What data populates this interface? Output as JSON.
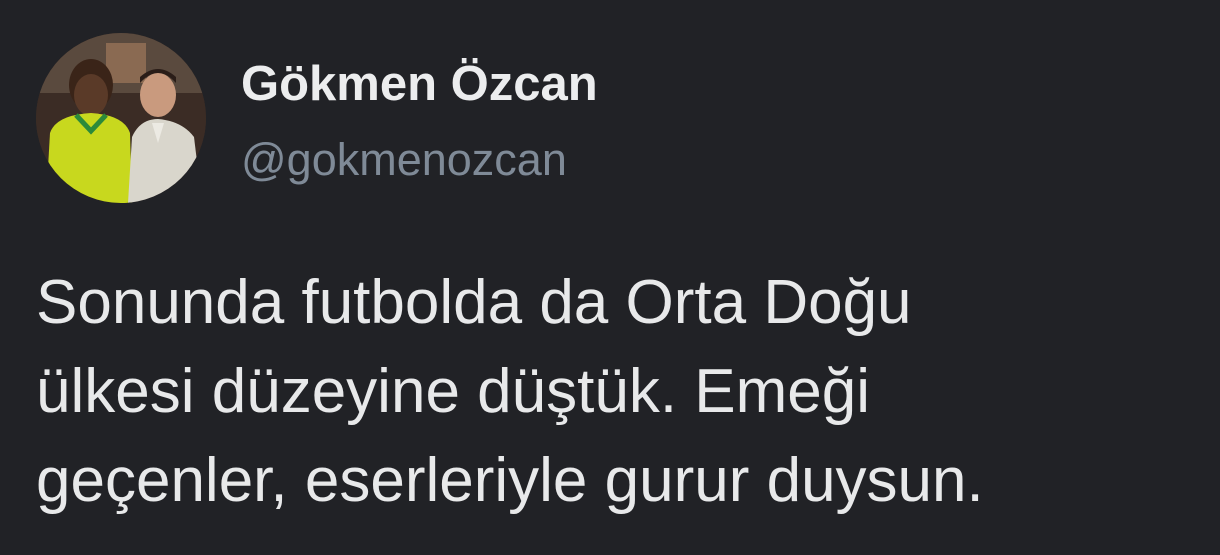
{
  "tweet": {
    "author": {
      "display_name": "Gökmen Özcan",
      "handle": "@gokmenozcan",
      "avatar_icon": "profile-photo"
    },
    "text_lines": [
      "Sonunda futbolda da Orta Doğu",
      "ülkesi düzeyine düştük. Emeği",
      "geçenler, eserleriyle gurur duysun."
    ]
  },
  "colors": {
    "background": "#212226",
    "name": "#ecedee",
    "handle": "#7f8a97",
    "text": "#e8e9ea"
  }
}
